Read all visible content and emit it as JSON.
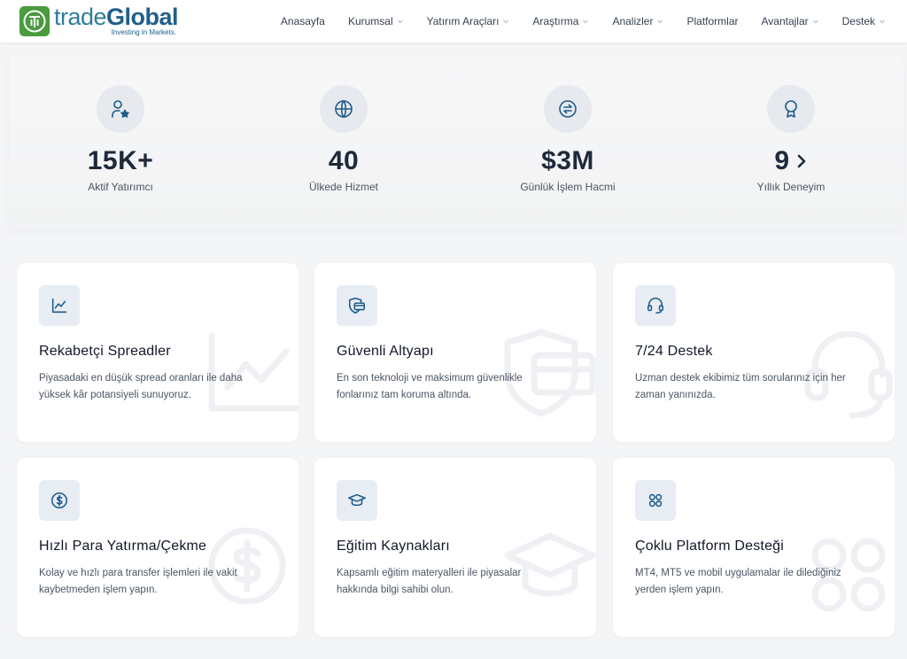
{
  "brand": {
    "name_part1": "trade",
    "name_part2": "Global",
    "tagline": "Investing in Markets.",
    "color": "#4a9a3e"
  },
  "nav": {
    "items": [
      {
        "label": "Anasayfa",
        "dropdown": false
      },
      {
        "label": "Kurumsal",
        "dropdown": true
      },
      {
        "label": "Yatırım Araçları",
        "dropdown": true
      },
      {
        "label": "Araştırma",
        "dropdown": true
      },
      {
        "label": "Analizler",
        "dropdown": true
      },
      {
        "label": "Platformlar",
        "dropdown": false
      },
      {
        "label": "Avantajlar",
        "dropdown": true
      },
      {
        "label": "Destek",
        "dropdown": true
      }
    ]
  },
  "stats": [
    {
      "icon": "user-star-icon",
      "value": "15K+",
      "label": "Aktif Yatırımcı"
    },
    {
      "icon": "globe-icon",
      "value": "40",
      "label": "Ülkede Hizmet"
    },
    {
      "icon": "exchange-icon",
      "value": "$3M",
      "label": "Günlük İşlem Hacmi"
    },
    {
      "icon": "award-icon",
      "value": "9",
      "label": "Yıllık Deneyim"
    }
  ],
  "features": [
    {
      "icon": "chart-line-icon",
      "title": "Rekabetçi Spreadler",
      "desc": "Piyasadaki en düşük spread oranları ile daha yüksek kâr potansiyeli sunuyoruz."
    },
    {
      "icon": "shield-icon",
      "title": "Güvenli Altyapı",
      "desc": "En son teknoloji ve maksimum güvenlikle fonlarınız tam koruma altında."
    },
    {
      "icon": "headset-icon",
      "title": "7/24 Destek",
      "desc": "Uzman destek ekibimiz tüm sorularınız için her zaman yanınızda."
    },
    {
      "icon": "dollar-icon",
      "title": "Hızlı Para Yatırma/Çekme",
      "desc": "Kolay ve hızlı para transfer işlemleri ile vakit kaybetmeden işlem yapın."
    },
    {
      "icon": "graduation-cap-icon",
      "title": "Eğitim Kaynakları",
      "desc": "Kapsamlı eğitim materyalleri ile piyasalar hakkında bilgi sahibi olun."
    },
    {
      "icon": "platforms-icon",
      "title": "Çoklu Platform Desteği",
      "desc": "MT4, MT5 ve mobil uygulamalar ile dilediğiniz yerden işlem yapın."
    }
  ],
  "colors": {
    "accent": "#1f5f8b",
    "icon": "#1e5b8a",
    "watermark": "#eef0f3"
  }
}
